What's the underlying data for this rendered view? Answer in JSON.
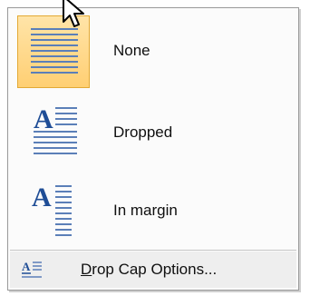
{
  "menu": {
    "items": [
      {
        "label": "None",
        "icon": "drop-cap-none-icon",
        "selected": true
      },
      {
        "label": "Dropped",
        "icon": "drop-cap-dropped-icon",
        "selected": false
      },
      {
        "label": "In margin",
        "icon": "drop-cap-in-margin-icon",
        "selected": false
      }
    ],
    "footer": {
      "mnemonic": "D",
      "label_rest": "rop Cap Options...",
      "icon": "drop-cap-options-icon"
    },
    "colors": {
      "selected_fill": "#ffcf73",
      "selected_border": "#e3a935",
      "line_blue": "#5b7fb8",
      "letter_blue": "#1f4d96"
    }
  }
}
